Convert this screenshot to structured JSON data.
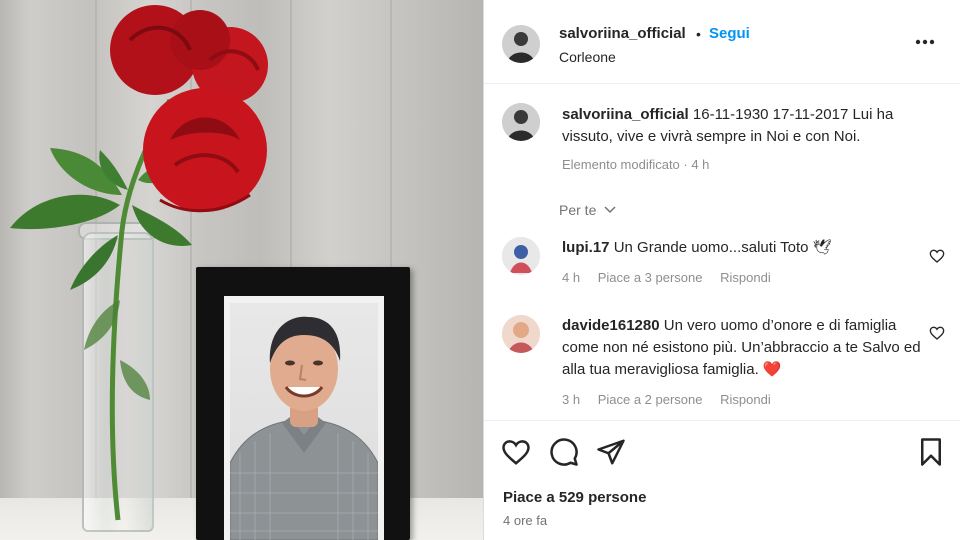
{
  "post": {
    "header": {
      "username": "salvoriina_official",
      "follow_separator": "•",
      "follow_label": "Segui",
      "location": "Corleone"
    },
    "caption": {
      "username": "salvoriina_official",
      "text": "16-11-1930 17-11-2017 Lui ha vissuto, vive e vivrà sempre in Noi e con Noi.",
      "edited_meta": "Elemento modificato · 4 h"
    },
    "comments_filter": "Per te",
    "comments": [
      {
        "username": "lupi.17",
        "text": "Un Grande uomo...saluti Toto 🕊",
        "time": "4 h",
        "likes": "Piace a 3 persone",
        "reply": "Rispondi"
      },
      {
        "username": "davide161280",
        "text": "Un vero uomo d’onore e di famiglia come non né esistono più. Un’abbraccio a te Salvo ed alla tua meravigliosa famiglia. ❤️",
        "time": "3 h",
        "likes": "Piace a 2 persone",
        "reply": "Rispondi"
      }
    ],
    "likes_count": "Piace a 529 persone",
    "posted_ago": "4 ore fa"
  },
  "icons": {
    "like": "heart-outline-icon",
    "comment": "speech-bubble-icon",
    "share": "paper-plane-icon",
    "save": "bookmark-icon",
    "more": "more-horizontal-icon"
  },
  "colors": {
    "follow_blue": "#0095f6",
    "rose_red": "#c8141c",
    "heart_red": "#ed2e3c"
  }
}
